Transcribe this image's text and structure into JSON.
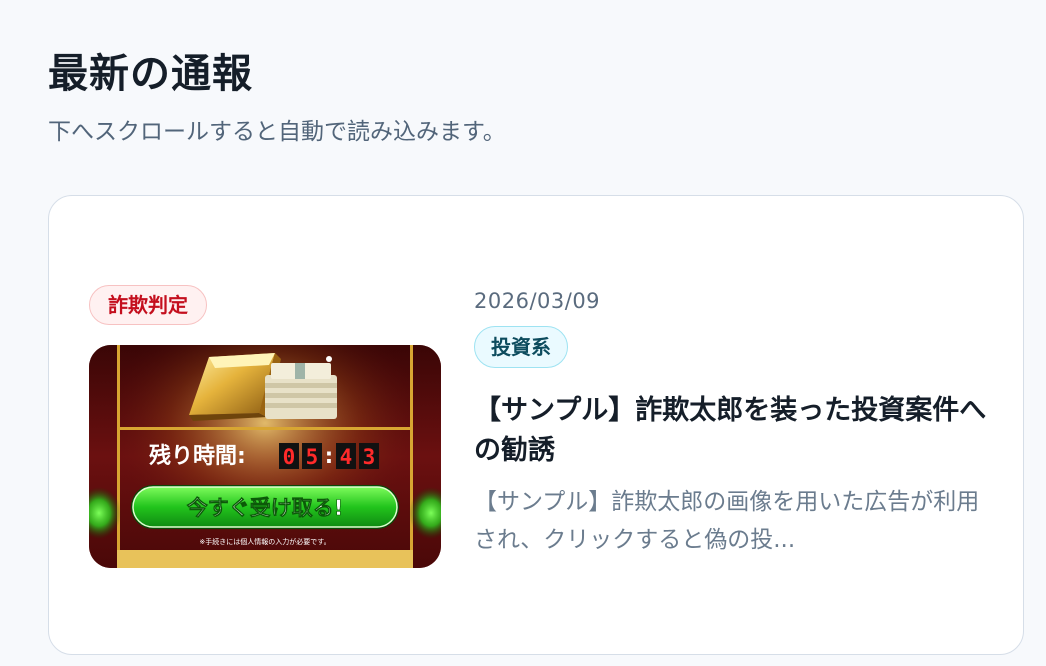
{
  "header": {
    "title": "最新の通報",
    "subtitle": "下へスクロールすると自動で読み込みます。"
  },
  "report": {
    "verdict": "詐欺判定",
    "date": "2026/03/09",
    "category": "投資系",
    "title": "【サンプル】詐欺太郎を装った投資案件への勧誘",
    "excerpt": "【サンプル】詐欺太郎の画像を用いた広告が利用され、クリックすると偽の投...",
    "thumbnail": {
      "timer_label": "残り時間:",
      "timer_digits": [
        "0",
        "5",
        "4",
        "3"
      ],
      "cta_label": "今すぐ受け取る!",
      "note": "※手続きには個人情報の入力が必要です。",
      "colors": {
        "background": "#5a0d0d",
        "cta_green": "#22c41c",
        "gold": "#d8a632",
        "digit_red": "#ff2a2a"
      }
    }
  },
  "colors": {
    "verdict_text": "#c40f1e",
    "category_text": "#0d4c5e",
    "page_background": "#f7f9fc"
  }
}
